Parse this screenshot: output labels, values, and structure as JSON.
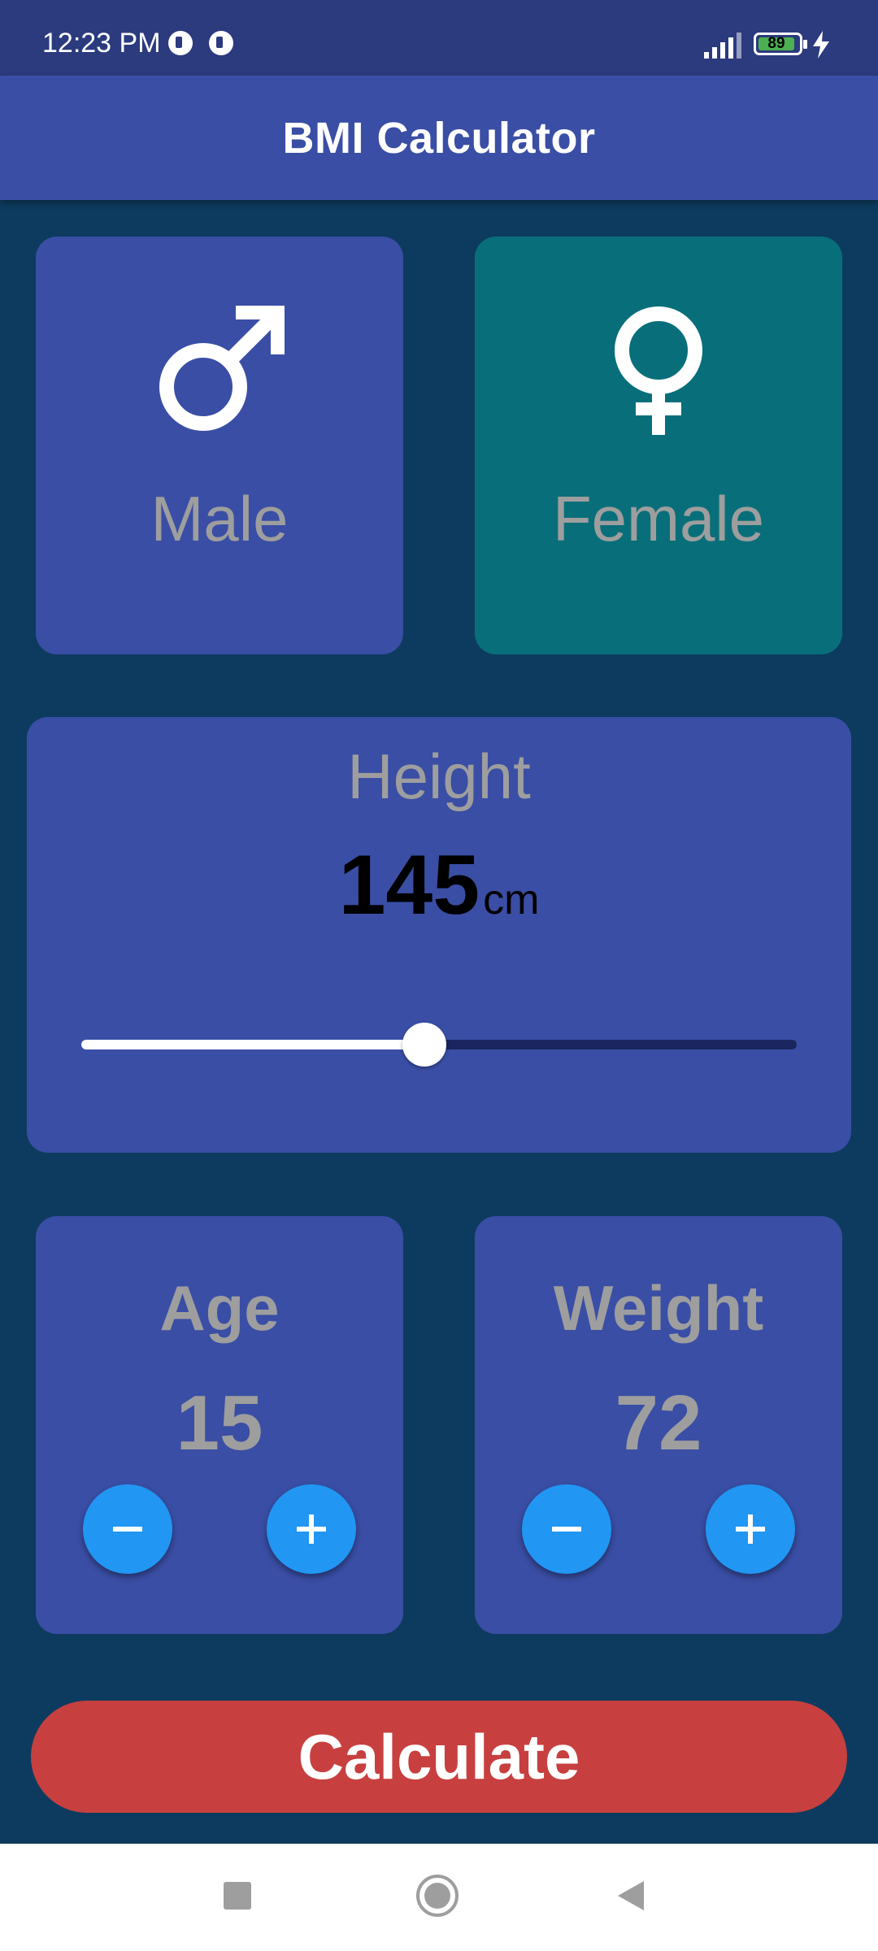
{
  "status_bar": {
    "time": "12:23 PM",
    "battery_level": "89",
    "battery_color": "#4caf50"
  },
  "app_bar": {
    "title": "BMI Calculator",
    "color": "#3a4ea5"
  },
  "gender": {
    "male_label": "Male",
    "female_label": "Female",
    "selected": "female",
    "selected_color": "#086f7a",
    "unselected_color": "#3a4ea5"
  },
  "height": {
    "label": "Height",
    "value": "145",
    "unit": "cm",
    "slider_fraction": 0.48
  },
  "age": {
    "label": "Age",
    "value": "15"
  },
  "weight": {
    "label": "Weight",
    "value": "72"
  },
  "calculate_button": {
    "label": "Calculate",
    "color": "#c7403f"
  },
  "colors": {
    "background": "#0d3b5f",
    "button_blue": "#2196f3"
  }
}
